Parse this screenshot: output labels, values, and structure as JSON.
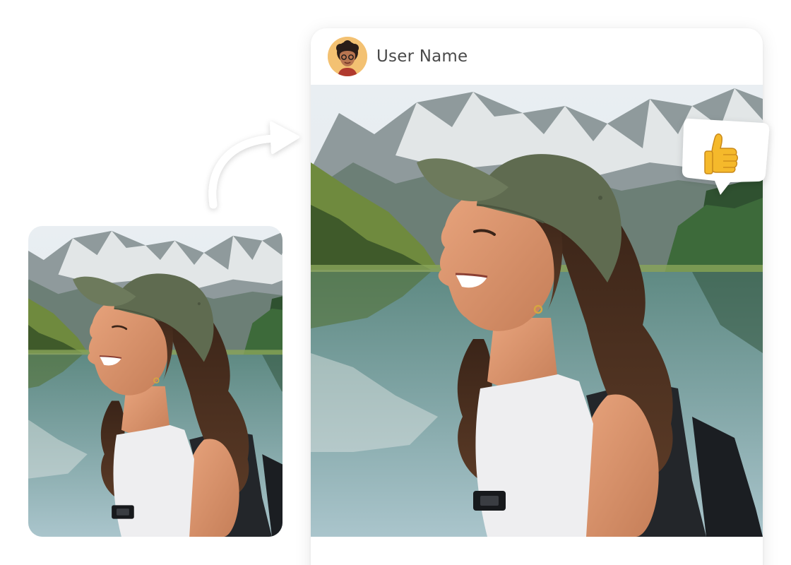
{
  "post": {
    "user_name": "User Name",
    "avatar": "avatar-illustration"
  },
  "icons": {
    "reaction": "thumbs-up-icon",
    "arrow": "curved-arrow-icon"
  },
  "colors": {
    "avatar_bg": "#f3c172",
    "thumb": "#f5b92b",
    "card_bg": "#ffffff"
  }
}
